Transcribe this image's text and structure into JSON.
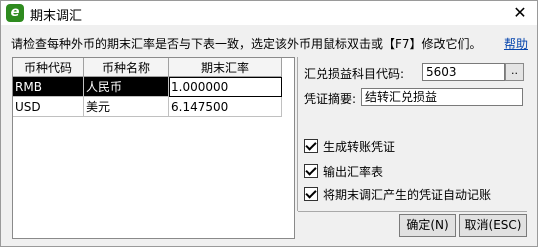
{
  "window": {
    "title": "期末调汇",
    "app_icon_letter": "e",
    "close_glyph": "✕"
  },
  "hint_text": "请检查每种外币的期末汇率是否与下表一致，选定该外币用鼠标双击或【F7】修改它们。",
  "help_link": "帮助",
  "table": {
    "columns": [
      "币种代码",
      "币种名称",
      "期末汇率"
    ],
    "rows": [
      {
        "code": "RMB",
        "name": "人民币",
        "rate": "1.000000",
        "selected": true
      },
      {
        "code": "USD",
        "name": "美元",
        "rate": "6.147500",
        "selected": false
      }
    ]
  },
  "form": {
    "account_label": "汇兑损益科目代码:",
    "account_value": "5603",
    "browse_label": "..",
    "summary_label": "凭证摘要:",
    "summary_value": "结转汇兑损益"
  },
  "options": [
    {
      "label": "生成转账凭证",
      "checked": true
    },
    {
      "label": "输出汇率表",
      "checked": true
    },
    {
      "label": "将期末调汇产生的凭证自动记账",
      "checked": true
    }
  ],
  "buttons": {
    "ok": "确定(N)",
    "cancel": "取消(ESC)"
  },
  "colors": {
    "app_icon": "#2e8b1f",
    "link": "#0645ad",
    "selected_row": "#000000"
  }
}
